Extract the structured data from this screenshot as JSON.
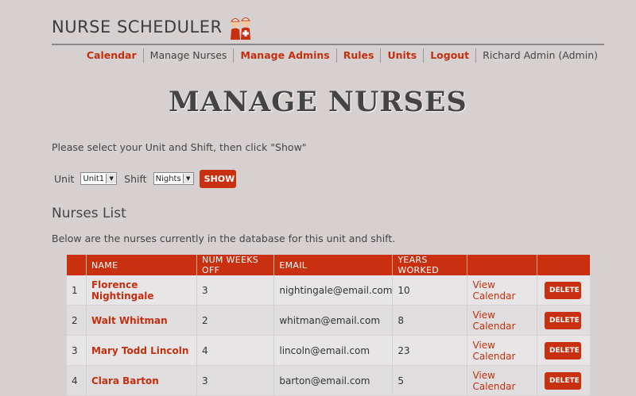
{
  "brand": {
    "title": "NURSE SCHEDULER"
  },
  "nav": [
    {
      "label": "Calendar",
      "type": "link"
    },
    {
      "label": "Manage Nurses",
      "type": "plain"
    },
    {
      "label": "Manage Admins",
      "type": "link"
    },
    {
      "label": "Rules",
      "type": "link"
    },
    {
      "label": "Units",
      "type": "link"
    },
    {
      "label": "Logout",
      "type": "link"
    },
    {
      "label": "Richard Admin (Admin)",
      "type": "plain"
    }
  ],
  "page_title": "MANAGE NURSES",
  "instructions": "Please select your Unit and Shift, then click \"Show\"",
  "filters": {
    "unit_label": "Unit",
    "unit_value": "Unit1",
    "shift_label": "Shift",
    "shift_value": "Nights",
    "show_label": "SHOW"
  },
  "nurses": {
    "title": "Nurses List",
    "description": "Below are the nurses currently in the database for this unit and shift.",
    "columns": [
      "",
      "NAME",
      "NUM WEEKS OFF",
      "EMAIL",
      "YEARS WORKED",
      "",
      ""
    ],
    "rows": [
      {
        "num": "1",
        "name": "Florence Nightingale",
        "weeks_off": "3",
        "email": "nightingale@email.com",
        "years": "10",
        "calendar": "View Calendar",
        "delete": "DELETE"
      },
      {
        "num": "2",
        "name": "Walt Whitman",
        "weeks_off": "2",
        "email": "whitman@email.com",
        "years": "8",
        "calendar": "View Calendar",
        "delete": "DELETE"
      },
      {
        "num": "3",
        "name": "Mary Todd Lincoln",
        "weeks_off": "4",
        "email": "lincoln@email.com",
        "years": "23",
        "calendar": "View Calendar",
        "delete": "DELETE"
      },
      {
        "num": "4",
        "name": "Clara Barton",
        "weeks_off": "3",
        "email": "barton@email.com",
        "years": "5",
        "calendar": "View Calendar",
        "delete": "DELETE"
      }
    ]
  },
  "colors": {
    "accent": "#c83010",
    "background": "#d6d0d0"
  }
}
